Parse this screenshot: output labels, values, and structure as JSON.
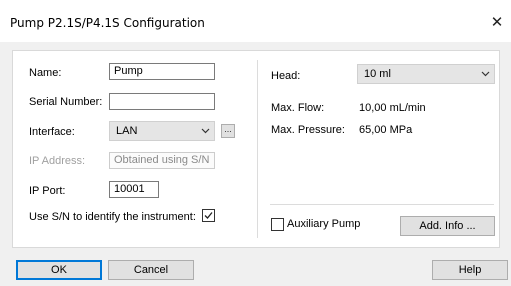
{
  "window": {
    "title": "Pump P2.1S/P4.1S Configuration",
    "close_glyph": "✕"
  },
  "left": {
    "name_label": "Name:",
    "name_value": "Pump",
    "serial_label": "Serial Number:",
    "serial_value": "",
    "interface_label": "Interface:",
    "interface_value": "LAN",
    "interface_browse": "...",
    "ip_address_label": "IP Address:",
    "ip_address_value": "Obtained using S/N",
    "ip_port_label": "IP Port:",
    "ip_port_value": "10001",
    "use_sn_label": "Use S/N to identify the instrument:",
    "use_sn_checked": true
  },
  "right": {
    "head_label": "Head:",
    "head_value": "10 ml",
    "max_flow_label": "Max. Flow:",
    "max_flow_value": "10,00 mL/min",
    "max_pressure_label": "Max. Pressure:",
    "max_pressure_value": "65,00 MPa",
    "aux_pump_label": "Auxiliary Pump",
    "aux_pump_checked": false,
    "add_info_label": "Add. Info ..."
  },
  "footer": {
    "ok_label": "OK",
    "cancel_label": "Cancel",
    "help_label": "Help"
  },
  "icons": {
    "chevron": "chevron-down-icon",
    "check": "checkmark-icon",
    "close": "close-icon"
  }
}
